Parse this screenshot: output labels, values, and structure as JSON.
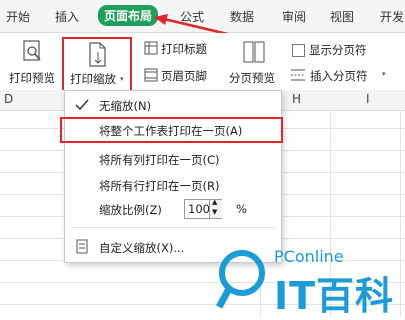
{
  "tabs": [
    "开始",
    "插入",
    "页面布局",
    "公式",
    "数据",
    "审阅",
    "视图",
    "开发"
  ],
  "active_tab": "页面布局",
  "ribbon": {
    "print_preview": "打印预览",
    "print_scale": "打印缩放",
    "print_titles": "打印标题",
    "header_footer": "页眉页脚",
    "page_break_preview": "分页预览",
    "show_page_breaks": "显示分页符",
    "insert_page_break": "插入分页符"
  },
  "columns": [
    "D",
    "H",
    "I"
  ],
  "menu": {
    "no_scale": "无缩放(N)",
    "fit_sheet": "将整个工作表打印在一页(A)",
    "fit_columns": "将所有列打印在一页(C)",
    "fit_rows": "将所有行打印在一页(R)",
    "scale_label": "缩放比例(Z)",
    "scale_value": "100",
    "scale_unit": "%",
    "custom_scale": "自定义缩放(X)..."
  },
  "watermark": {
    "brand": "PConline",
    "name": "IT百科"
  },
  "colors": {
    "accent": "#1e9f5b",
    "highlight": "#e0262a",
    "logo": "#1b9bd7"
  }
}
